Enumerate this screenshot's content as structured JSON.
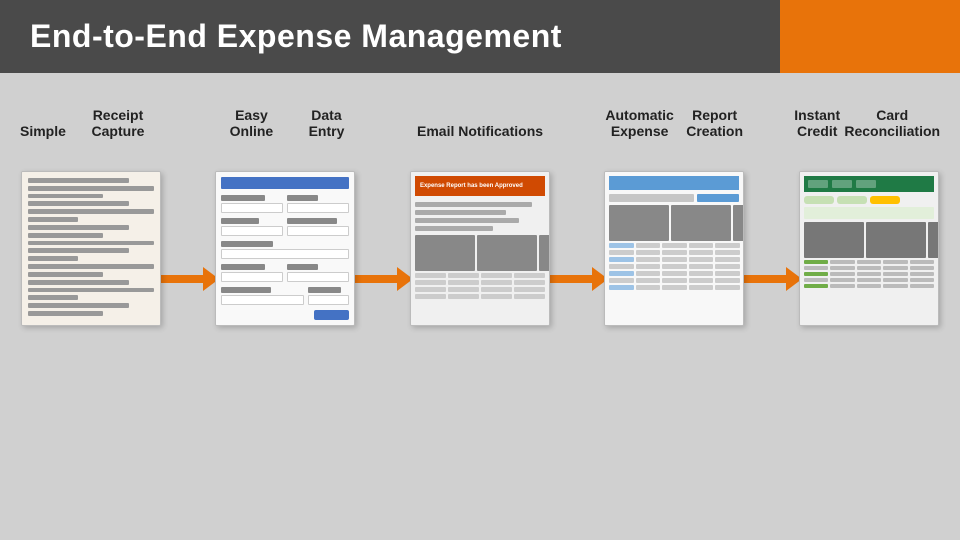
{
  "header": {
    "title": "End-to-End Expense Management"
  },
  "steps": [
    {
      "id": "simple-receipt",
      "label_line1": "Simple",
      "label_line2": "Receipt Capture",
      "type": "receipt"
    },
    {
      "id": "easy-online",
      "label_line1": "Easy Online",
      "label_line2": "Data Entry",
      "type": "form"
    },
    {
      "id": "email-notifications",
      "label_line1": "Email",
      "label_line2": "Notifications",
      "type": "email"
    },
    {
      "id": "automatic-expense",
      "label_line1": "Automatic Expense",
      "label_line2": "Report Creation",
      "type": "report"
    },
    {
      "id": "instant-credit",
      "label_line1": "Instant Credit",
      "label_line2": "Card Reconciliation",
      "type": "credit"
    }
  ],
  "arrow": {
    "color": "#e8730a"
  }
}
